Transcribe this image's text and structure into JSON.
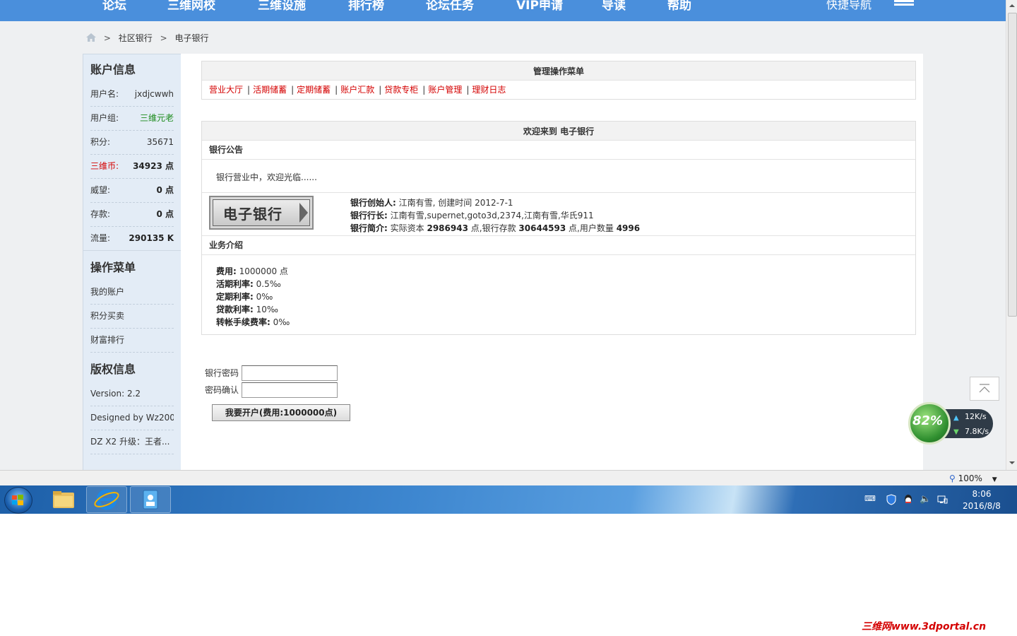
{
  "topnav": {
    "items": [
      "论坛",
      "三维网校",
      "三维设施",
      "排行榜",
      "论坛任务",
      "VIP申请",
      "导读",
      "帮助"
    ],
    "quick_nav": "快捷导航"
  },
  "breadcrumb": {
    "items": [
      "社区银行",
      "电子银行"
    ],
    "sep": ">"
  },
  "sidebar": {
    "account_title": "账户信息",
    "account_rows": [
      {
        "label": "用户名:",
        "value": "jxdjcwwh"
      },
      {
        "label": "用户组:",
        "value": "三维元老"
      },
      {
        "label": "积分:",
        "value": "35671"
      },
      {
        "label": "三维币:",
        "value": "34923 点"
      },
      {
        "label": "威望:",
        "value": "0 点"
      },
      {
        "label": "存款:",
        "value": "0 点"
      },
      {
        "label": "流量:",
        "value": "290135 K"
      }
    ],
    "menu_title": "操作菜单",
    "menu_items": [
      "我的账户",
      "积分买卖",
      "财富排行"
    ],
    "copyright_title": "版权信息",
    "copyright_items": [
      "Version: 2.2",
      "Designed by Wz200...",
      "DZ X2 升级：王者..."
    ]
  },
  "main": {
    "menu_box_title": "管理操作菜单",
    "menu_links": [
      "营业大厅",
      "活期储蓄",
      "定期储蓄",
      "账户汇款",
      "贷款专柜",
      "账户管理",
      "理财日志"
    ],
    "menu_sep": "|",
    "welcome_title": "欢迎来到 电子银行",
    "notice_title": "银行公告",
    "notice_text": "银行营业中，欢迎光临......",
    "bank_logo_text": "电子银行",
    "bank_founder_label": "银行创始人:",
    "bank_founder_value": "江南有雪, 创建时间 2012-7-1",
    "bank_president_label": "银行行长:",
    "bank_president_value": "江南有雪,supernet,goto3d,2374,江南有雪,华氏911",
    "bank_intro_label": "银行简介:",
    "bank_intro_p1": "实际资本",
    "bank_intro_capital": "2986943",
    "bank_intro_p2": "点,银行存款",
    "bank_intro_deposit": "30644593",
    "bank_intro_p3": "点,用户数量",
    "bank_intro_users": "4996",
    "biz_title": "业务介绍",
    "biz_rows": [
      {
        "label": "费用:",
        "value": "1000000 点"
      },
      {
        "label": "活期利率:",
        "value": "0.5‰"
      },
      {
        "label": "定期利率:",
        "value": "0‰"
      },
      {
        "label": "贷款利率:",
        "value": "10‰"
      },
      {
        "label": "转帐手续费率:",
        "value": "0‰"
      }
    ],
    "password_label": "银行密码",
    "password_value": "",
    "confirm_label": "密码确认",
    "confirm_value": "",
    "open_button": "我要开户(费用:1000000点)"
  },
  "speed_widget": {
    "percent": "82%",
    "upload": "12K/s",
    "download": "7.8K/s"
  },
  "statusbar": {
    "zoom": "100%"
  },
  "taskbar": {
    "time": "8:06",
    "date": "2016/8/8"
  },
  "watermark": "三维网www.3dportal.cn",
  "colors": {
    "nav_blue": "#4a8fdc",
    "link_red": "#d40000",
    "group_green": "#1a8a1a"
  }
}
